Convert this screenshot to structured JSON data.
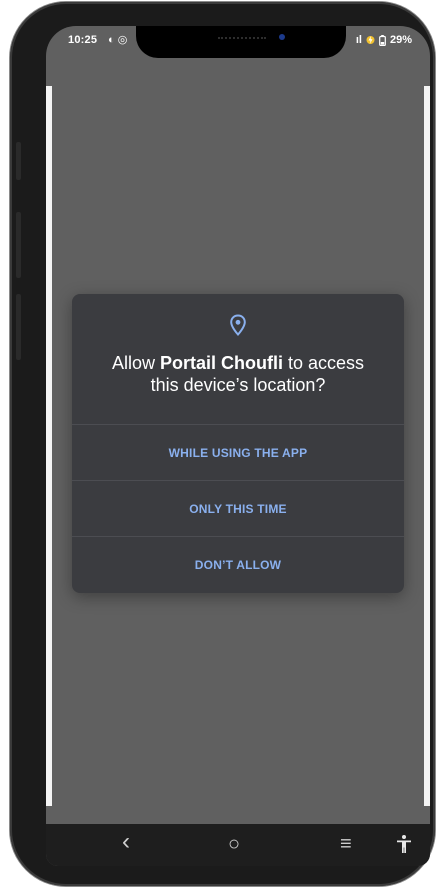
{
  "statusbar": {
    "time": "10:25",
    "left_icons": "◐ ◎",
    "signal": "ıl",
    "battery": "29%"
  },
  "dialog": {
    "icon": "location-pin-icon",
    "title_prefix": "Allow ",
    "app_name": "Portail Choufli",
    "title_suffix_1": " to access",
    "title_line2": "this device’s location?",
    "options": [
      {
        "label": "WHILE USING THE APP"
      },
      {
        "label": "ONLY THIS TIME"
      },
      {
        "label": "DON’T ALLOW"
      }
    ]
  },
  "navbar": {
    "back": "‹",
    "home": "○",
    "recents": "≡",
    "accessibility": "accessibility-icon"
  },
  "colors": {
    "dialog_bg": "#3b3c40",
    "accent": "#8ab0ee",
    "scrim": "#606060"
  }
}
